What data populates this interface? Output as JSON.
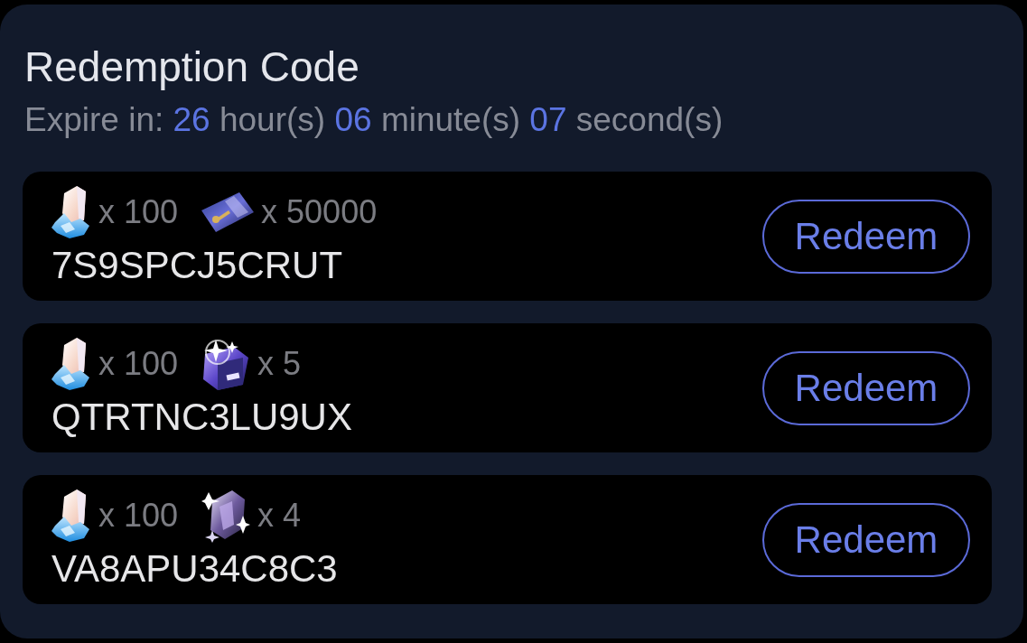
{
  "panel": {
    "title": "Redemption Code",
    "expiry": {
      "label": "Expire in:",
      "parts": [
        {
          "value": "26",
          "unit": "hour(s)"
        },
        {
          "value": "06",
          "unit": "minute(s)"
        },
        {
          "value": "07",
          "unit": "second(s)"
        }
      ]
    }
  },
  "codes": [
    {
      "rewards": [
        {
          "kind": "crystal",
          "amount": "x 100"
        },
        {
          "kind": "card",
          "amount": "x 50000"
        }
      ],
      "code": "7S9SPCJ5CRUT",
      "button": "Redeem"
    },
    {
      "rewards": [
        {
          "kind": "crystal",
          "amount": "x 100"
        },
        {
          "kind": "cube",
          "amount": "x 5"
        }
      ],
      "code": "QTRTNC3LU9UX",
      "button": "Redeem"
    },
    {
      "rewards": [
        {
          "kind": "crystal",
          "amount": "x 100"
        },
        {
          "kind": "gem",
          "amount": "x 4"
        }
      ],
      "code": "VA8APU34C8C3",
      "button": "Redeem"
    }
  ]
}
